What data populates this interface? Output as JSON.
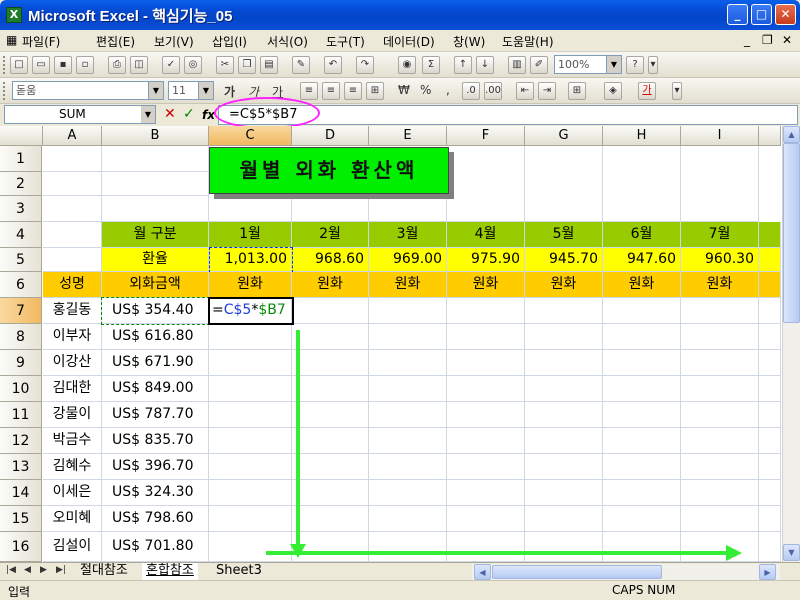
{
  "window": {
    "title": "Microsoft Excel - 핵심기능_05",
    "app_icon": "X",
    "min": "_",
    "max": "□",
    "close": "✕"
  },
  "menu": {
    "items": [
      "파일(F)",
      "편집(E)",
      "보기(V)",
      "삽입(I)",
      "서식(O)",
      "도구(T)",
      "데이터(D)",
      "창(W)",
      "도움말(H)"
    ],
    "mdi_min": "_",
    "mdi_restore": "❐",
    "mdi_close": "✕"
  },
  "toolbar": {
    "zoom": "100%",
    "font_name": "돋움",
    "font_size": "11",
    "sigma": "Σ",
    "currency": "₩",
    "percent": "%",
    "comma": ",",
    "bold": "가",
    "italic": "가",
    "underline": "가",
    "font_color_glyph": "가"
  },
  "formula_bar": {
    "name_box": "SUM",
    "cancel": "✕",
    "enter": "✓",
    "fx": "fx",
    "formula": "=C$5*$B7"
  },
  "sheet": {
    "columns": [
      "A",
      "B",
      "C",
      "D",
      "E",
      "F",
      "G",
      "H",
      "I"
    ],
    "rows": [
      "1",
      "2",
      "3",
      "4",
      "5",
      "6",
      "7",
      "8",
      "9",
      "10",
      "11",
      "12",
      "13",
      "14",
      "15",
      "16"
    ],
    "title_box": "월별 외화 환산액",
    "month_label": "월 구분",
    "months": [
      "1월",
      "2월",
      "3월",
      "4월",
      "5월",
      "6월",
      "7월"
    ],
    "rate_label": "환율",
    "rates": [
      "1,013.00",
      "968.60",
      "969.00",
      "975.90",
      "945.70",
      "947.60",
      "960.30"
    ],
    "col_name_header": "성명",
    "col_amount_header": "외화금액",
    "unit_label": "원화",
    "people": [
      {
        "name": "홍길동",
        "amount": "US$ 354.40"
      },
      {
        "name": "이부자",
        "amount": "US$ 616.80"
      },
      {
        "name": "이강산",
        "amount": "US$ 671.90"
      },
      {
        "name": "김대한",
        "amount": "US$ 849.00"
      },
      {
        "name": "강물이",
        "amount": "US$ 787.70"
      },
      {
        "name": "박금수",
        "amount": "US$ 835.70"
      },
      {
        "name": "김혜수",
        "amount": "US$ 396.70"
      },
      {
        "name": "이세은",
        "amount": "US$ 324.30"
      },
      {
        "name": "오미혜",
        "amount": "US$ 798.60"
      },
      {
        "name": "김설이",
        "amount": "US$ 701.80"
      }
    ],
    "editing_formula": "=C$5*$B7"
  },
  "tabs": {
    "nav_first": "|◀",
    "nav_prev": "◀",
    "nav_next": "▶",
    "nav_last": "▶|",
    "items": [
      "절대참조",
      "혼합참조",
      "Sheet3"
    ],
    "active": "혼합참조"
  },
  "status": {
    "mode": "입력",
    "caps": "CAPS NUM"
  },
  "colors": {
    "green": "#99cc00",
    "yellow": "#ffff00",
    "orange": "#ffcc00",
    "title_green": "#00ee00",
    "annotation_pink": "#ff20ff",
    "annotation_arrow": "#33ee33"
  }
}
